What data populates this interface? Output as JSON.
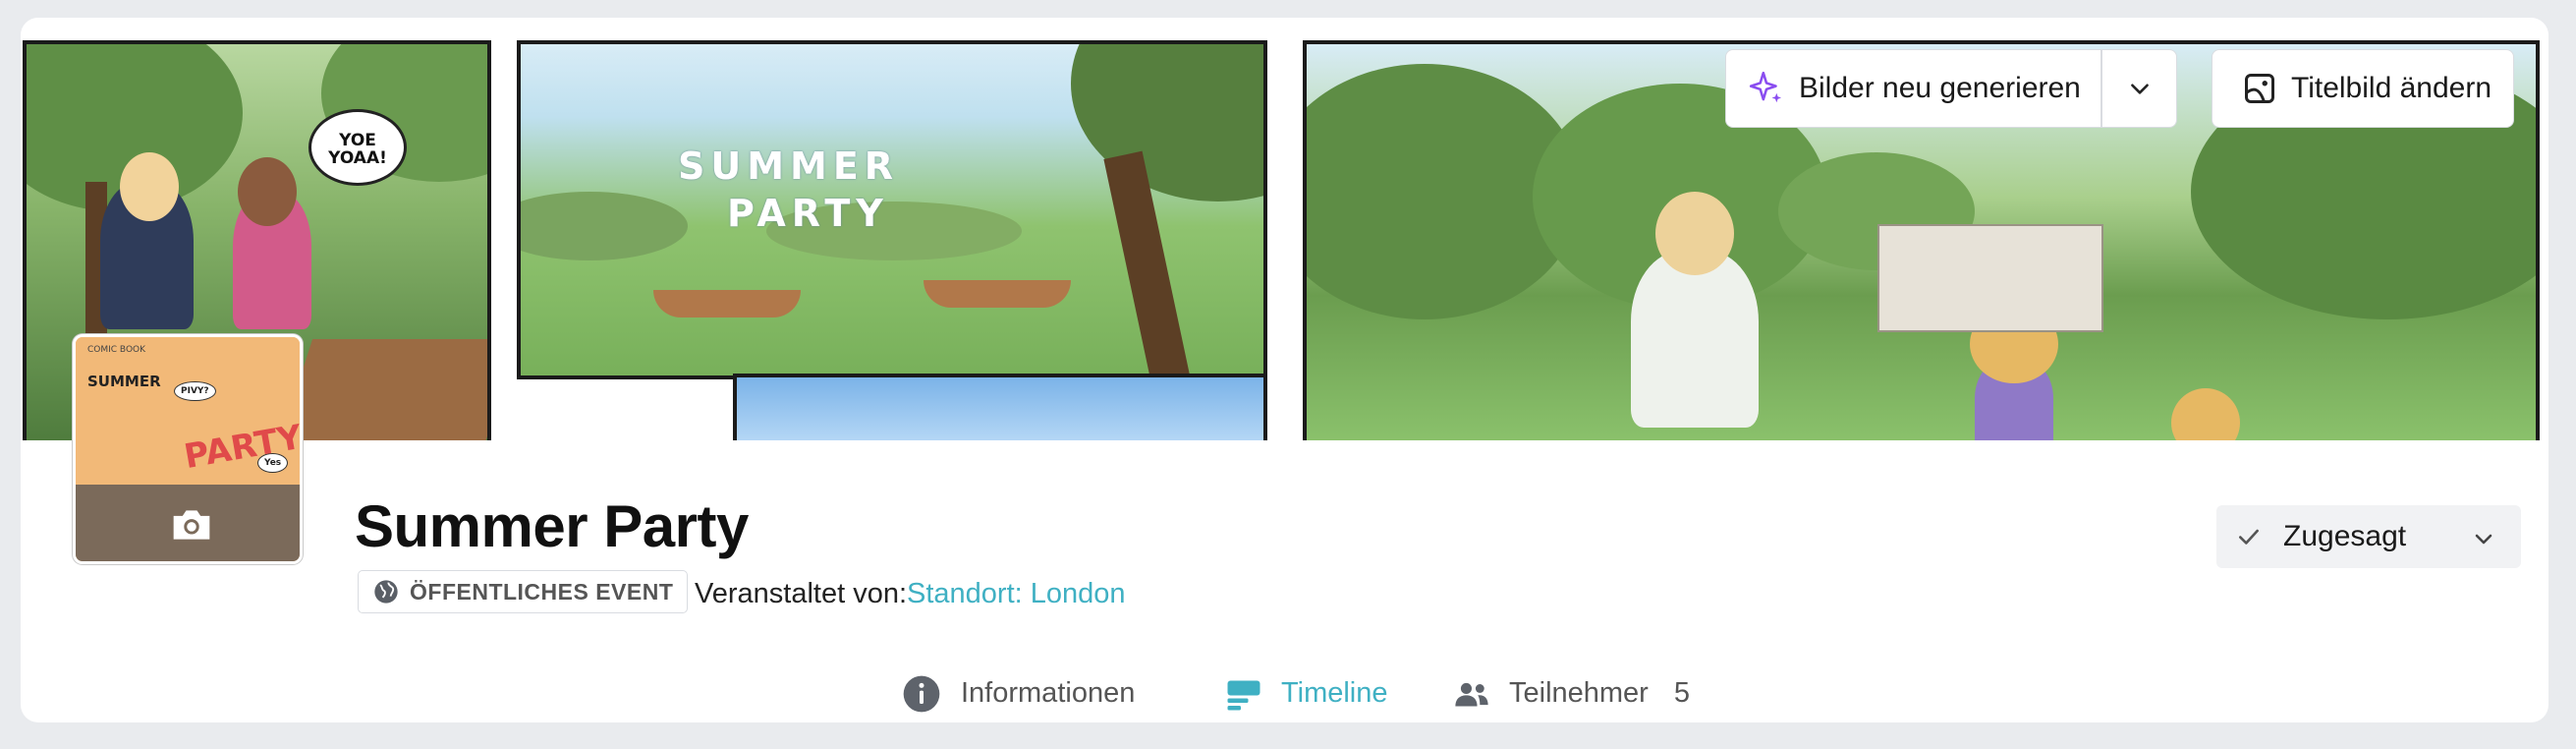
{
  "cover": {
    "comic_bubble": "YOE YOAA!",
    "comic_title_line1": "SUMMER",
    "comic_title_line2": "PARTY",
    "regenerate_label": "Bilder neu generieren",
    "regenerate_icon": "sparkle-icon",
    "regenerate_menu_icon": "chevron-down-icon",
    "change_cover_label": "Titelbild ändern",
    "change_cover_icon": "image-frame-icon"
  },
  "thumbnail": {
    "title": "SUMMER",
    "subtitle": "COMIC BOOK",
    "art_text": "PARTY",
    "badge1": "PIVY?",
    "badge2": "Yes",
    "camera_icon": "camera-icon"
  },
  "event": {
    "title": "Summer Party",
    "visibility_badge": "ÖFFENTLICHES EVENT",
    "visibility_icon": "globe-icon",
    "host_prefix": "Veranstaltet von:",
    "host_link": "Standort: London"
  },
  "rsvp": {
    "status": "Zugesagt",
    "status_icon": "check-icon",
    "menu_icon": "chevron-down-icon"
  },
  "tabs": [
    {
      "label": "Informationen",
      "icon": "info-icon",
      "active": false
    },
    {
      "label": "Timeline",
      "icon": "timeline-icon",
      "active": true
    },
    {
      "label": "Teilnehmer",
      "icon": "people-icon",
      "count": "5",
      "active": false
    }
  ],
  "colors": {
    "accent": "#3fb0c3",
    "sparkle": "#8a4df0",
    "page_bg": "#e9ebee"
  }
}
